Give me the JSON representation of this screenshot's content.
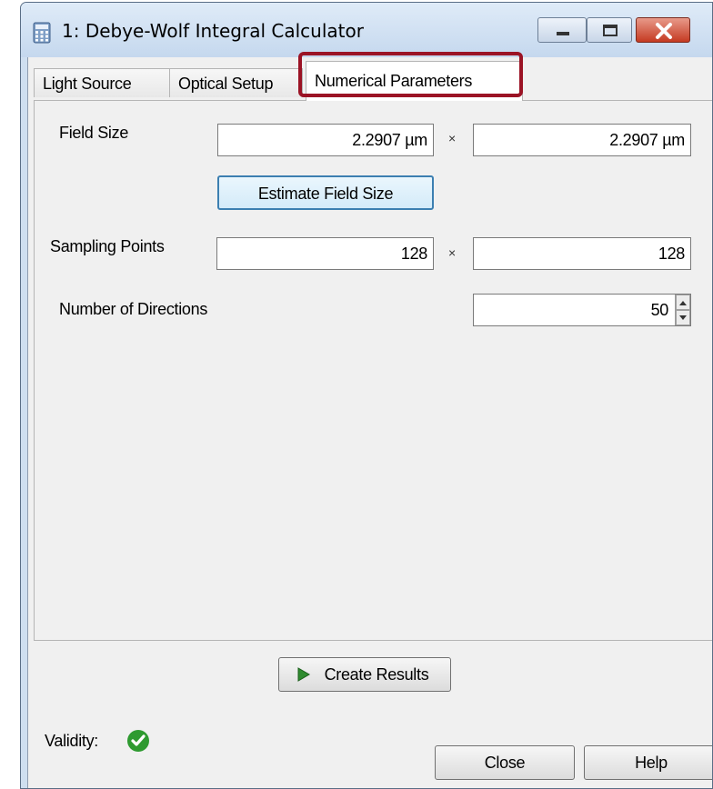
{
  "window": {
    "title": "1: Debye-Wolf Integral Calculator"
  },
  "tabs": [
    {
      "label": "Light Source"
    },
    {
      "label": "Optical Setup"
    },
    {
      "label": "Numerical Parameters",
      "selected": true
    }
  ],
  "numerical": {
    "field_size": {
      "label": "Field Size",
      "x_value": "2.2907 µm",
      "y_value": "2.2907 µm",
      "separator": "×"
    },
    "estimate_button": "Estimate Field Size",
    "sampling_points": {
      "label": "Sampling Points",
      "x_value": "128",
      "y_value": "128",
      "separator": "×"
    },
    "directions": {
      "label": "Number of Directions",
      "value": "50"
    }
  },
  "footer": {
    "create_results": "Create Results",
    "validity_label": "Validity:",
    "close": "Close",
    "help": "Help"
  },
  "colors": {
    "highlight": "#9b1325",
    "valid": "#2e9a30"
  }
}
